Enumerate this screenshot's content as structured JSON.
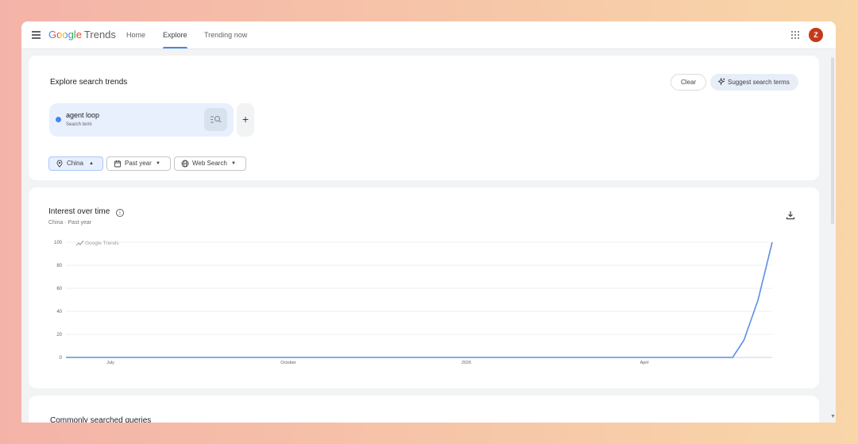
{
  "topbar": {
    "logo_google": "Google",
    "logo_trends": "Trends",
    "nav": [
      {
        "label": "Home"
      },
      {
        "label": "Explore",
        "active": true
      },
      {
        "label": "Trending now"
      }
    ],
    "avatar_letter": "Z",
    "icons": {
      "menu": "menu-icon",
      "apps": "apps-grid-icon"
    }
  },
  "explore": {
    "title": "Explore search trends",
    "clear_label": "Clear",
    "suggest_label": "Suggest search terms",
    "term": {
      "name": "agent loop",
      "type": "Search term",
      "color": "#4285f4"
    },
    "add_label": "+",
    "filters": [
      {
        "label": "China",
        "icon": "location-pin-icon",
        "caret": "▲",
        "selected": true
      },
      {
        "label": "Past year",
        "icon": "calendar-icon",
        "caret": "▼"
      },
      {
        "label": "Web Search",
        "icon": "globe-icon",
        "caret": "▼"
      }
    ]
  },
  "interest": {
    "title": "Interest over time",
    "subtitle": "China · Past year",
    "watermark": "Google Trends"
  },
  "chart_data": {
    "type": "line",
    "title": "Interest over time",
    "xlabel": "",
    "ylabel": "",
    "ylim": [
      0,
      100
    ],
    "y_ticks": [
      0,
      20,
      40,
      60,
      80,
      100
    ],
    "x_tick_labels": [
      "July",
      "October",
      "2026",
      "April"
    ],
    "grid": true,
    "series": [
      {
        "name": "agent loop",
        "color": "#5c8fe6",
        "points": [
          [
            0,
            0
          ],
          [
            0.944,
            0
          ],
          [
            0.96,
            15
          ],
          [
            0.98,
            50
          ],
          [
            1,
            100
          ]
        ]
      }
    ]
  },
  "queries": {
    "title": "Commonly searched queries"
  },
  "colors": {
    "accent": "#4285f4",
    "avatar": "#c5391b"
  }
}
